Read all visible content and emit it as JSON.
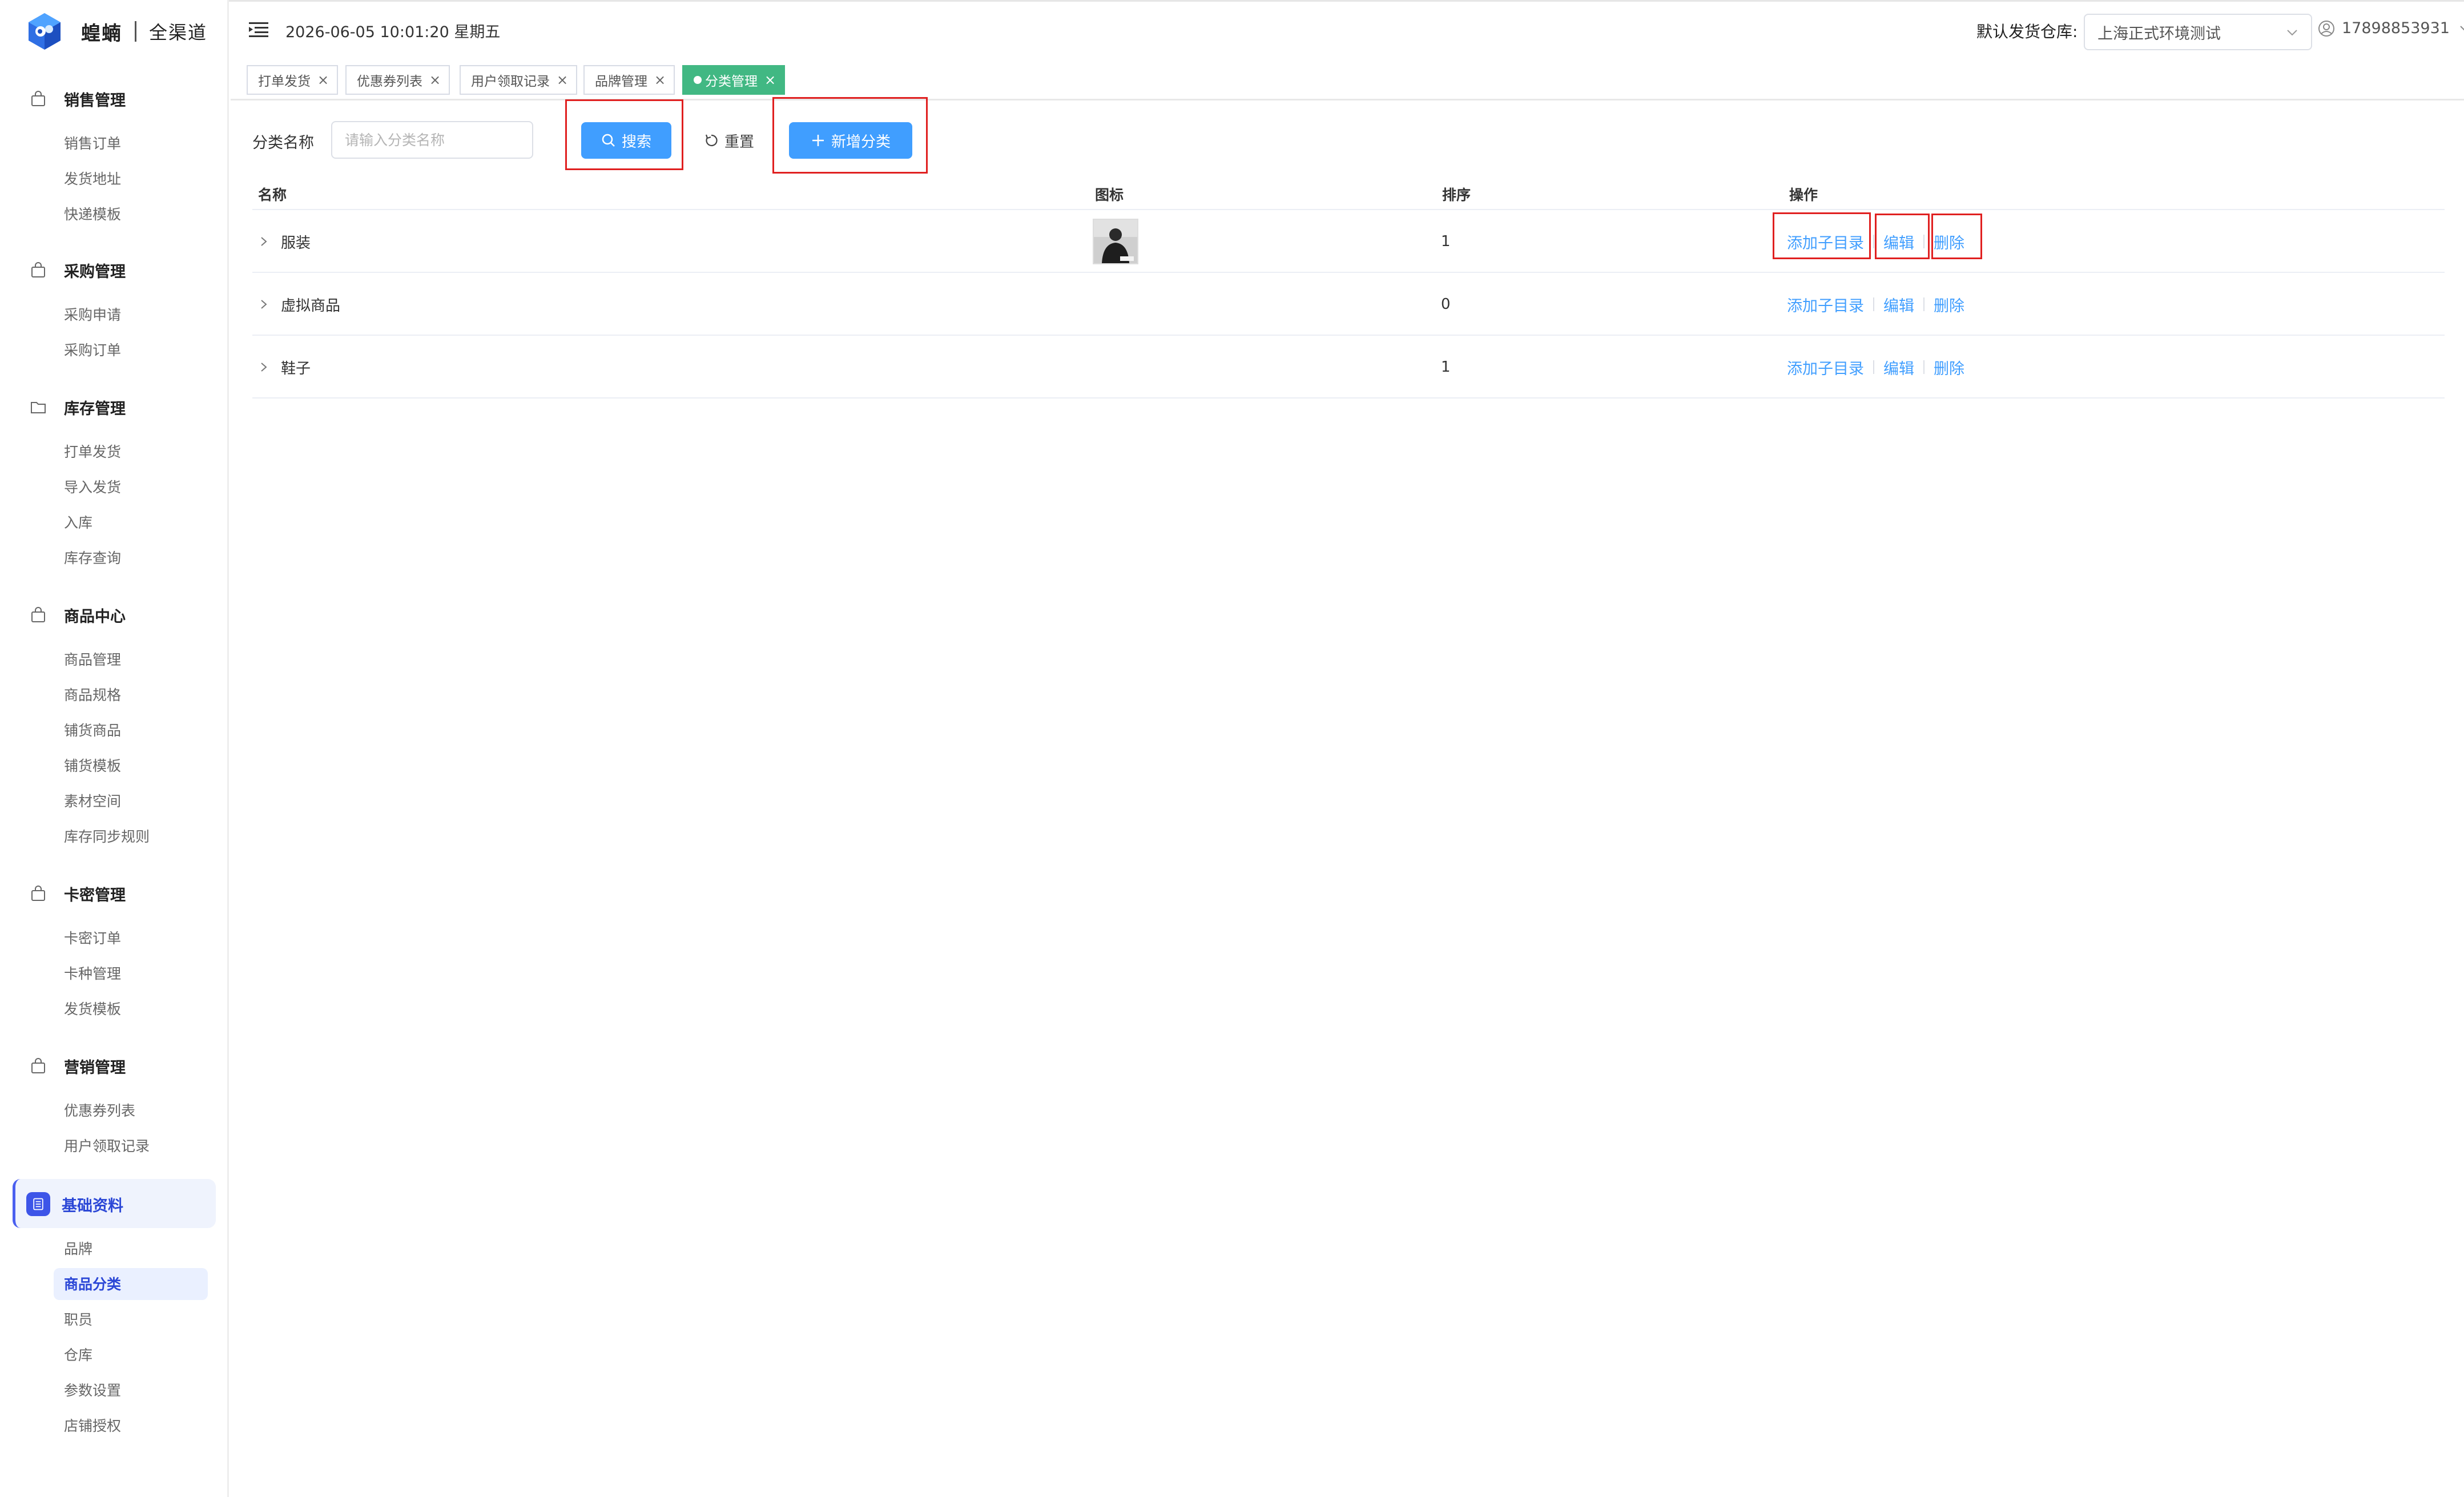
{
  "brand": {
    "name": "蝗蝻",
    "sub": "全渠道"
  },
  "sidebar": {
    "groups": [
      {
        "title": "销售管理",
        "icon": "bag-icon",
        "items": [
          "销售订单",
          "发货地址",
          "快递模板"
        ]
      },
      {
        "title": "采购管理",
        "icon": "bag-icon",
        "items": [
          "采购申请",
          "采购订单"
        ]
      },
      {
        "title": "库存管理",
        "icon": "folder-icon",
        "items": [
          "打单发货",
          "导入发货",
          "入库",
          "库存查询"
        ]
      },
      {
        "title": "商品中心",
        "icon": "bag-icon",
        "items": [
          "商品管理",
          "商品规格",
          "铺货商品",
          "铺货模板",
          "素材空间",
          "库存同步规则"
        ]
      },
      {
        "title": "卡密管理",
        "icon": "bag-icon",
        "items": [
          "卡密订单",
          "卡种管理",
          "发货模板"
        ]
      },
      {
        "title": "营销管理",
        "icon": "bag-icon",
        "items": [
          "优惠券列表",
          "用户领取记录"
        ]
      },
      {
        "title": "基础资料",
        "icon": "book-icon",
        "items": [
          "品牌",
          "商品分类",
          "职员",
          "仓库",
          "参数设置",
          "店铺授权"
        ]
      }
    ],
    "active_group": "基础资料",
    "active_item": "商品分类"
  },
  "header": {
    "datetime": "2026-06-05 10:01:20 星期五",
    "warehouse_label": "默认发货仓库:",
    "warehouse_value": "上海正式环境测试",
    "user": "17898853931"
  },
  "tabs": [
    {
      "label": "打单发货",
      "active": false
    },
    {
      "label": "优惠券列表",
      "active": false
    },
    {
      "label": "用户领取记录",
      "active": false
    },
    {
      "label": "品牌管理",
      "active": false
    },
    {
      "label": "分类管理",
      "active": true
    }
  ],
  "search": {
    "label": "分类名称",
    "placeholder": "请输入分类名称",
    "value": "",
    "search_btn": "搜索",
    "reset_btn": "重置",
    "add_btn": "新增分类"
  },
  "table": {
    "columns": [
      "名称",
      "图标",
      "排序",
      "操作"
    ],
    "rows": [
      {
        "name": "服装",
        "has_icon": true,
        "sort": "1"
      },
      {
        "name": "虚拟商品",
        "has_icon": false,
        "sort": "0"
      },
      {
        "name": "鞋子",
        "has_icon": false,
        "sort": "1"
      }
    ],
    "actions": {
      "add_child": "添加子目录",
      "edit": "编辑",
      "delete": "删除"
    }
  },
  "colors": {
    "primary": "#409eff",
    "active_tab": "#41b883",
    "highlight_box": "#e02020",
    "sidebar_active": "#3d55e8"
  }
}
